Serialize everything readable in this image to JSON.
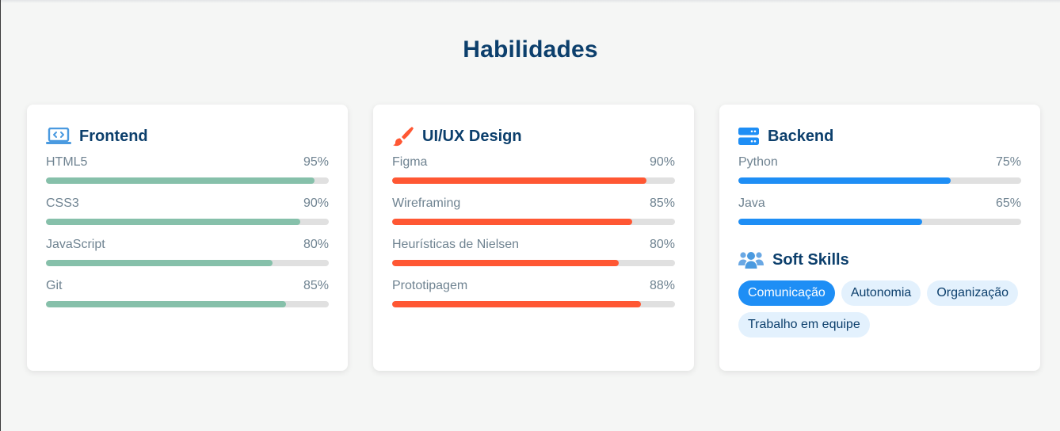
{
  "section": {
    "title": "Habilidades"
  },
  "cards": [
    {
      "title": "Frontend",
      "icon": "laptop-code-icon",
      "bar_color": "#86c0aa",
      "skills": [
        {
          "name": "HTML5",
          "percent_label": "95%",
          "value": 95
        },
        {
          "name": "CSS3",
          "percent_label": "90%",
          "value": 90
        },
        {
          "name": "JavaScript",
          "percent_label": "80%",
          "value": 80
        },
        {
          "name": "Git",
          "percent_label": "85%",
          "value": 85
        }
      ]
    },
    {
      "title": "UI/UX Design",
      "icon": "paintbrush-icon",
      "bar_color": "#ff5733",
      "skills": [
        {
          "name": "Figma",
          "percent_label": "90%",
          "value": 90
        },
        {
          "name": "Wireframing",
          "percent_label": "85%",
          "value": 85
        },
        {
          "name": "Heurísticas de Nielsen",
          "percent_label": "80%",
          "value": 80
        },
        {
          "name": "Prototipagem",
          "percent_label": "88%",
          "value": 88
        }
      ]
    },
    {
      "title": "Backend",
      "icon": "server-icon",
      "bar_color": "#1e8ef5",
      "skills": [
        {
          "name": "Python",
          "percent_label": "75%",
          "value": 75
        },
        {
          "name": "Java",
          "percent_label": "65%",
          "value": 65
        }
      ]
    }
  ],
  "soft_skills": {
    "title": "Soft Skills",
    "icon": "users-icon",
    "tags": [
      {
        "label": "Comunicação",
        "active": true
      },
      {
        "label": "Autonomia",
        "active": false
      },
      {
        "label": "Organização",
        "active": false
      },
      {
        "label": "Trabalho em equipe",
        "active": false
      }
    ]
  },
  "colors": {
    "heading": "#0c3f6c",
    "tag_active_bg": "#1e8ef5",
    "tag_bg": "#e3f1fd",
    "track": "#e0e0e0"
  }
}
